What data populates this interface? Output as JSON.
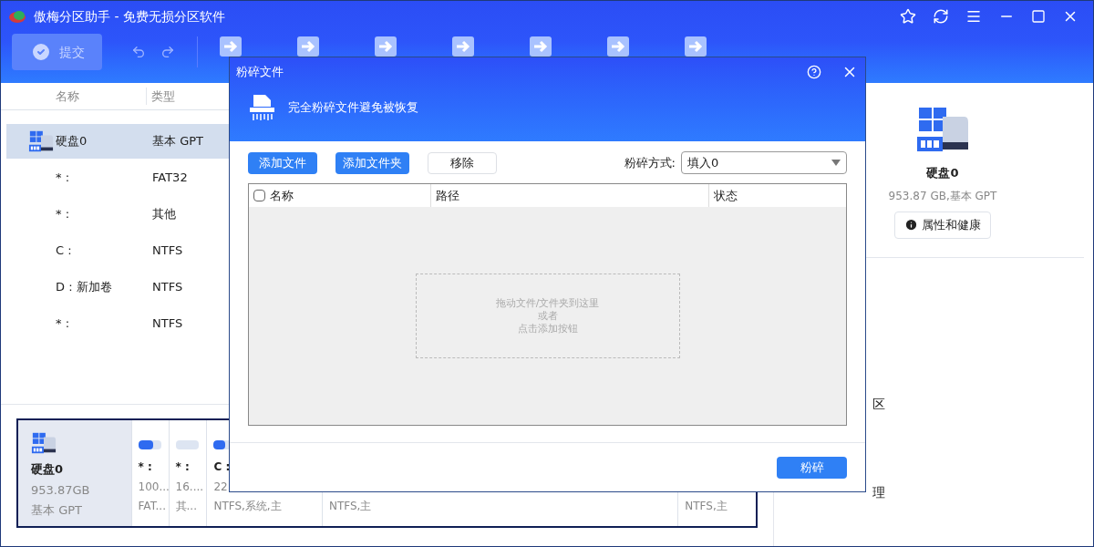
{
  "window": {
    "title": "傲梅分区助手 - 免费无损分区软件"
  },
  "toolbar": {
    "submit": {
      "label": "提交",
      "disabled": true
    }
  },
  "partition_list": {
    "columns": [
      "名称",
      "类型"
    ],
    "rows": [
      {
        "kind": "disk",
        "name": "硬盘0",
        "type": "基本 GPT",
        "selected": true
      },
      {
        "kind": "partition",
        "name": "* :",
        "type": "FAT32",
        "selected": false
      },
      {
        "kind": "partition",
        "name": "* :",
        "type": "其他",
        "selected": false
      },
      {
        "kind": "partition",
        "name": "C :",
        "type": "NTFS",
        "selected": false
      },
      {
        "kind": "partition",
        "name": "D : 新加卷",
        "type": "NTFS",
        "selected": false
      },
      {
        "kind": "partition",
        "name": "* :",
        "type": "NTFS",
        "selected": false
      }
    ]
  },
  "disk_map": {
    "disk": {
      "name": "硬盘0",
      "size": "953.87GB",
      "style": "基本 GPT",
      "selected": true
    },
    "partitions": [
      {
        "label": "* :",
        "size": "100...",
        "fs": "FAT...",
        "level": 0.65
      },
      {
        "label": "* :",
        "size": "16....",
        "fs": "其...",
        "level": 0
      },
      {
        "label": "C :",
        "size": "22",
        "fs": "NTFS,系统,主",
        "level": 0.5
      },
      {
        "fs": "NTFS,主"
      },
      {
        "fs": "NTFS,主"
      }
    ]
  },
  "right_panel": {
    "disk_name": "硬盘0",
    "disk_info": "953.87 GB,基本 GPT",
    "properties_button": "属性和健康",
    "items": [
      {
        "label": "区"
      },
      {
        "label": "理"
      }
    ]
  },
  "dialog": {
    "title": "粉碎文件",
    "header": "完全粉碎文件避免被恢复",
    "buttons": [
      {
        "label": "添加文件",
        "kind": "primary"
      },
      {
        "label": "添加文件夹",
        "kind": "primary"
      },
      {
        "label": "移除",
        "kind": "secondary"
      }
    ],
    "method": {
      "label": "粉碎方式:",
      "value": "填入0"
    },
    "table": {
      "select_all": false,
      "columns": [
        "名称",
        "路径",
        "状态"
      ]
    },
    "drop_hint": [
      "拖动文件/文件夹到这里",
      "或者",
      "点击添加按钮"
    ],
    "action": "粉碎"
  }
}
